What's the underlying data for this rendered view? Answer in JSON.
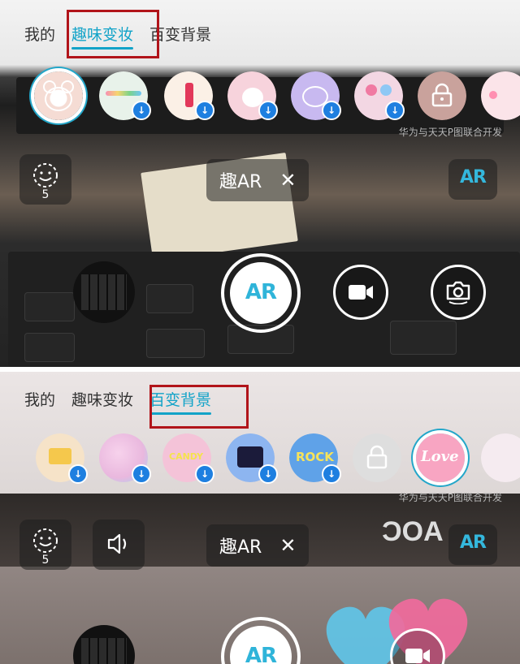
{
  "panel1": {
    "tabs": [
      {
        "label": "我的",
        "active": false
      },
      {
        "label": "趣味变妆",
        "active": true
      },
      {
        "label": "百变背景",
        "active": false
      }
    ],
    "stickers": [
      {
        "name": "bear-face",
        "selected": true,
        "download": false,
        "color": "#f5dcd4"
      },
      {
        "name": "rainbow-text",
        "selected": false,
        "download": true,
        "color": "#e8f2ea"
      },
      {
        "name": "lipstick-mask",
        "selected": false,
        "download": true,
        "color": "#fbf0e6"
      },
      {
        "name": "crown-cat",
        "selected": false,
        "download": true,
        "color": "#f7d3dc"
      },
      {
        "name": "neon-cat",
        "selected": false,
        "download": true,
        "color": "#c8b9f0"
      },
      {
        "name": "lollipop",
        "selected": false,
        "download": true,
        "color": "#f3d7e3"
      },
      {
        "name": "locked-lion",
        "selected": false,
        "download": false,
        "color": "#c9a29c"
      },
      {
        "name": "flower",
        "selected": false,
        "download": false,
        "color": "#fbe4e9"
      }
    ],
    "credit": "华为与天天P图联合开发",
    "face_count": "5",
    "ar_label": "趣AR",
    "close_symbol": "✕",
    "ar_logo": "AR",
    "shutter_label": "AR"
  },
  "panel2": {
    "tabs": [
      {
        "label": "我的",
        "active": false
      },
      {
        "label": "趣味变妆",
        "active": false
      },
      {
        "label": "百变背景",
        "active": true
      }
    ],
    "stickers": [
      {
        "name": "crown-card",
        "selected": false,
        "download": true,
        "color": "#f6e3c8"
      },
      {
        "name": "pink-cartoon",
        "selected": false,
        "download": true,
        "color": "#e9b8de"
      },
      {
        "name": "candy-candy",
        "selected": false,
        "download": true,
        "color": "#f4c3d8"
      },
      {
        "name": "party-text",
        "selected": false,
        "download": true,
        "color": "#8db5f0"
      },
      {
        "name": "rock-text",
        "selected": false,
        "download": true,
        "color": "#5fa2e8"
      },
      {
        "name": "locked-doodle",
        "selected": false,
        "download": false,
        "color": "#dedede"
      },
      {
        "name": "love-text",
        "selected": true,
        "download": false,
        "color": "#f8a5c2"
      },
      {
        "name": "bunny",
        "selected": false,
        "download": false,
        "color": "#f5ebf0"
      }
    ],
    "credit": "华为与天天P图联合开发",
    "face_count": "5",
    "ar_label": "趣AR",
    "close_symbol": "✕",
    "ar_logo": "AR",
    "shutter_label": "AR"
  },
  "colors": {
    "accent": "#12a3c8",
    "highlight_box": "#b1141a",
    "download_badge": "#1e7fe0"
  },
  "icons": {
    "face": "smiley-face-icon",
    "speaker": "speaker-icon",
    "video": "video-camera-icon",
    "flip": "camera-flip-icon",
    "download": "download-arrow-icon",
    "lock": "lock-icon"
  }
}
